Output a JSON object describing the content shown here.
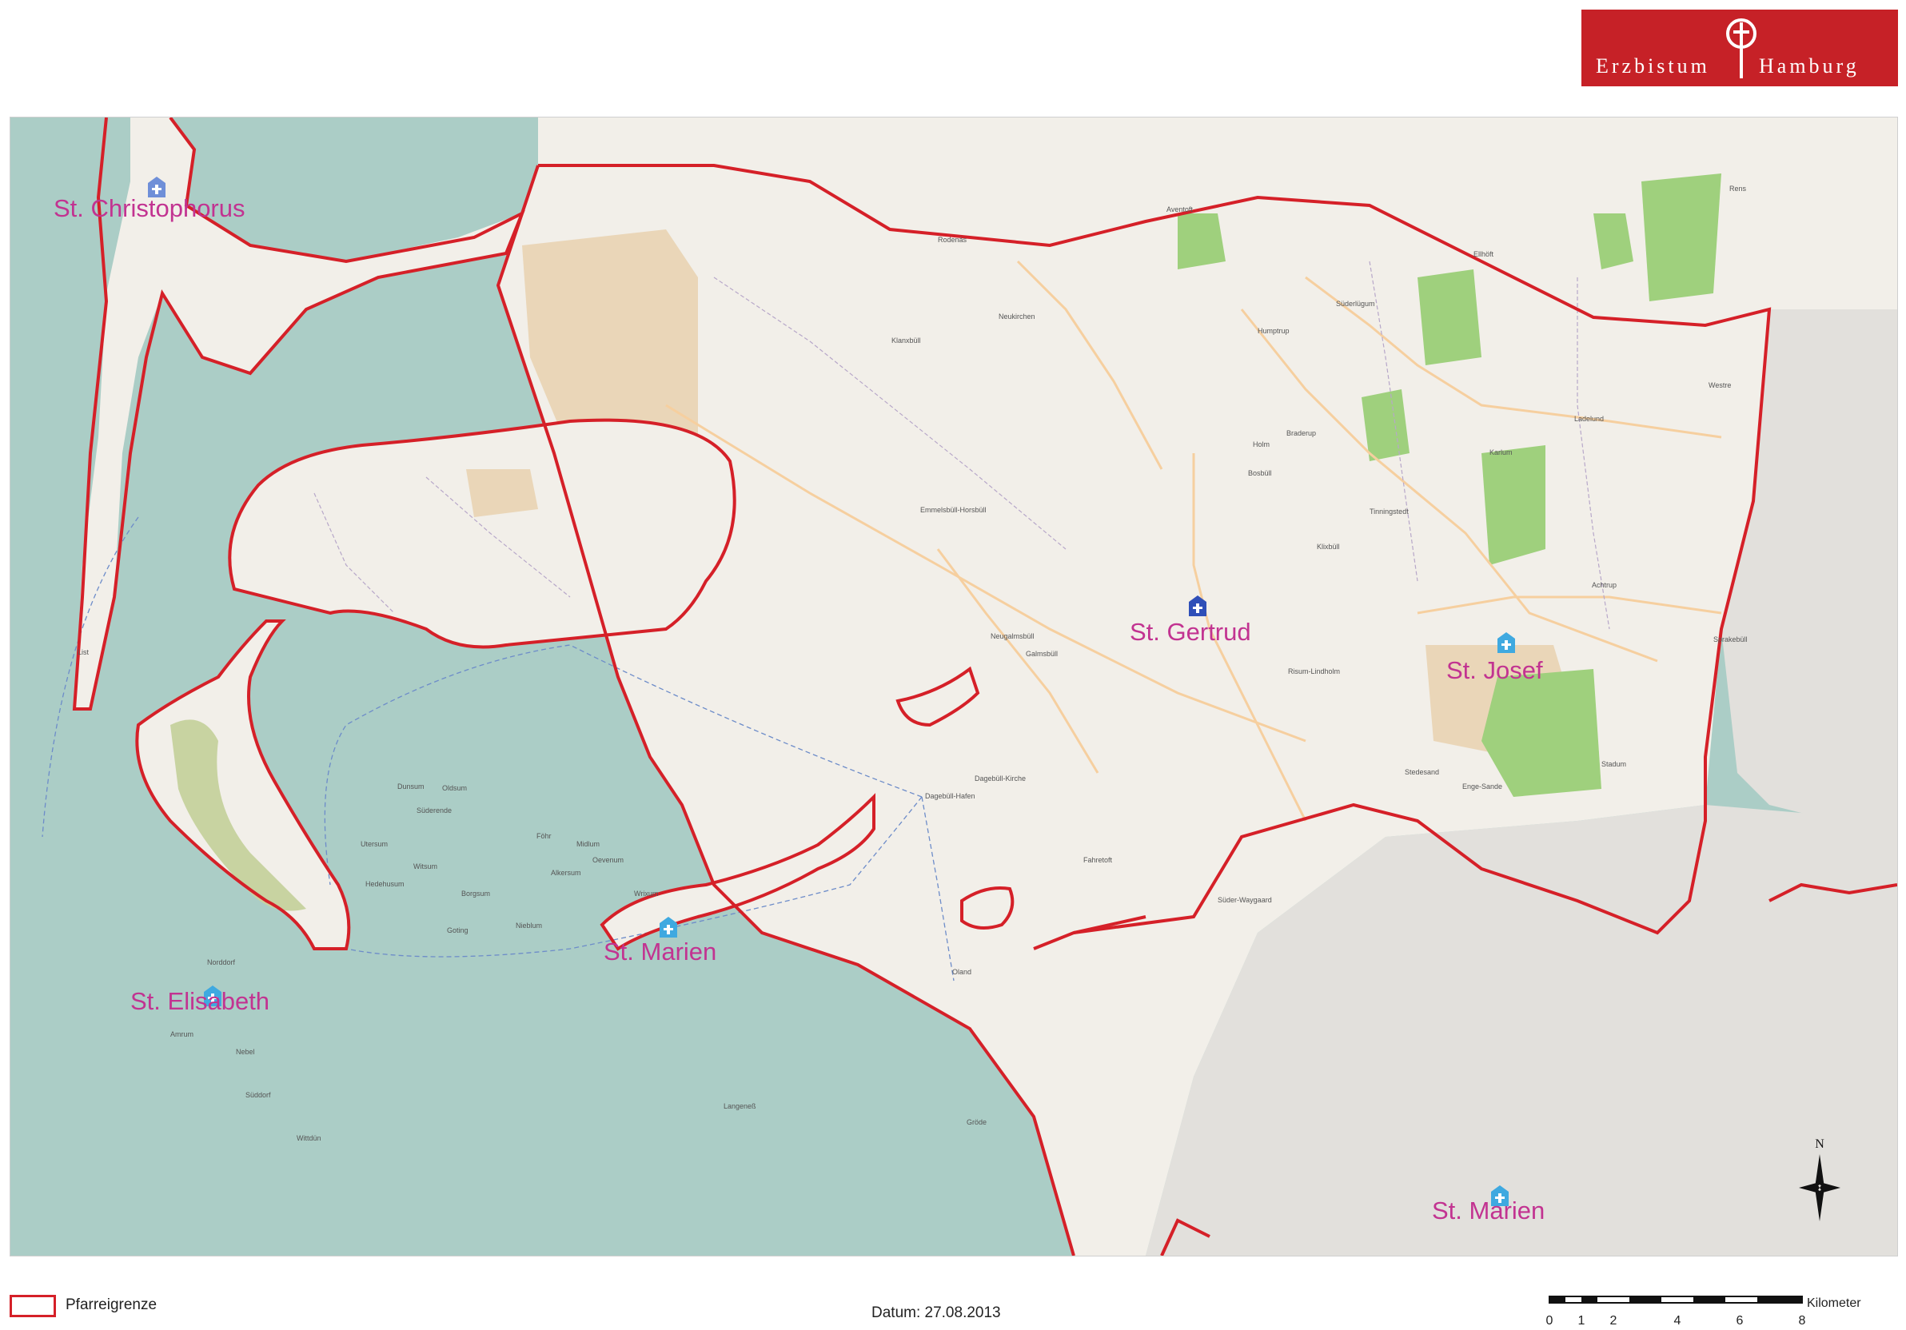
{
  "logo": {
    "text_left": "Erzbistum",
    "text_right": "Hamburg",
    "brand_color": "#c62127"
  },
  "parishes": [
    {
      "name": "St. Christophorus"
    },
    {
      "name": "St. Gertrud"
    },
    {
      "name": "St. Josef"
    },
    {
      "name": "St. Marien"
    },
    {
      "name": "St. Elisabeth"
    },
    {
      "name": "St. Marien"
    }
  ],
  "places": [
    "Rodenäs",
    "Neukirchen",
    "Klanxbüll",
    "Emmelsbüll-Horsbüll",
    "Aventoft",
    "Humptrup",
    "Süderlügum",
    "Ellhöft",
    "Ladelund",
    "Westre",
    "Karlum",
    "Achtrup",
    "Sprakebüll",
    "Stedesand",
    "Enge-Sande",
    "Stadum",
    "Risum-Lindholm",
    "Klixbüll",
    "Tinningstedt",
    "Bosbüll",
    "Braderup",
    "Holm",
    "Neugalmsbüll",
    "Galmsbüll",
    "Dagebüll-Kirche",
    "Fahretoft",
    "Süder-Waygaard",
    "Dunsum",
    "Oldsum",
    "Süderende",
    "Utersum",
    "Witsum",
    "Hedehusum",
    "Borgsum",
    "Goting",
    "Nieblum",
    "Alkersum",
    "Oevenum",
    "Midlum",
    "Wrixum",
    "Föhr",
    "Norddorf",
    "Nebel",
    "Süddorf",
    "Wittdün",
    "Amrum",
    "Oland",
    "Langeneß",
    "Gröde",
    "Rens",
    "List",
    "Dagebüll-Hafen"
  ],
  "legend": {
    "label": "Pfarreigrenze",
    "color": "#d52028"
  },
  "date_label": "Datum: 27.08.2013",
  "scale": {
    "unit": "Kilometer",
    "ticks": [
      "0",
      "1",
      "2",
      "4",
      "6",
      "8"
    ]
  },
  "north_label": "N",
  "colors": {
    "water": "#abcdc6",
    "land": "#f2efe9",
    "farmland": "#ead6b8",
    "forest": "#9fd07d",
    "outside": "#e2e0dc",
    "boundary": "#d52028",
    "parish_label": "#c23391",
    "road": "#f6cf9f"
  }
}
